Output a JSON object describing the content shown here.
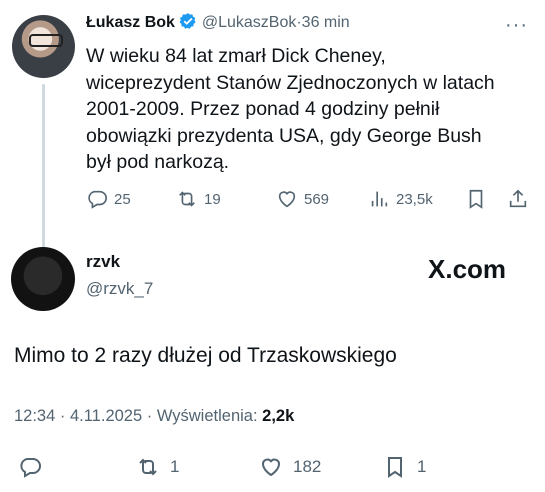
{
  "parent_tweet": {
    "display_name": "Łukasz Bok",
    "handle": "@LukaszBok",
    "separator": "·",
    "time": "36 min",
    "text": "W wieku 84 lat zmarł Dick Cheney,\nwiceprezydent Stanów Zjednoczonych w latach\n2001-2009. Przez ponad 4 godziny pełnił\nobowiązki prezydenta USA, gdy George Bush\nbył pod narkozą.",
    "replies": "25",
    "reposts": "19",
    "likes": "569",
    "views": "23,5k"
  },
  "reply_tweet": {
    "display_name": "rzvk",
    "handle": "@rzvk_7",
    "watermark": "X.com",
    "text": "Mimo to 2 razy dłużej od Trzaskowskiego",
    "time": "12:34",
    "date": "4.11.2025",
    "views_label": "Wyświetlenia:",
    "views": "2,2k",
    "reposts": "1",
    "likes": "182",
    "bookmarks": "1"
  },
  "colors": {
    "text": "#0f1419",
    "muted": "#536471",
    "verified": "#1d9bf0",
    "thread": "#cfd9de"
  }
}
